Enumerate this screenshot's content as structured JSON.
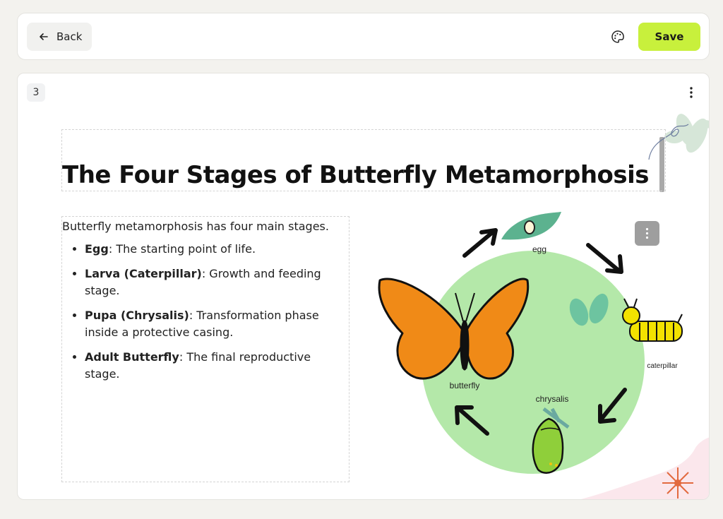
{
  "toolbar": {
    "back_label": "Back",
    "save_label": "Save",
    "accent_color": "#c8f03c"
  },
  "icons": {
    "back": "arrow-left-icon",
    "palette": "palette-icon",
    "menu": "more-vertical-icon"
  },
  "slide": {
    "number": "3",
    "title": "The Four Stages of Butterfly Metamorphosis",
    "intro": "Butterfly metamorphosis has four main stages.",
    "stages": [
      {
        "term": "Egg",
        "desc": ": The starting point of life."
      },
      {
        "term": "Larva (Caterpillar)",
        "desc": ": Growth and feeding stage."
      },
      {
        "term": "Pupa (Chrysalis)",
        "desc": ": Transformation phase inside a protective casing."
      },
      {
        "term": "Adult Butterfly",
        "desc": ": The final reproductive stage."
      }
    ],
    "diagram_labels": {
      "egg": "egg",
      "caterpillar": "caterpillar",
      "chrysalis": "chrysalis",
      "butterfly": "butterfly"
    }
  }
}
